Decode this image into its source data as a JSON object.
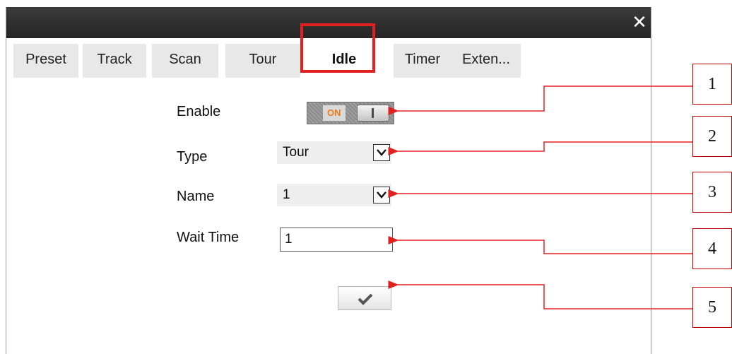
{
  "dialog": {
    "close_glyph": "✕",
    "tabs": [
      "Preset",
      "Track",
      "Scan",
      "Tour",
      "Idle",
      "Timer",
      "Exten..."
    ],
    "active_tab": "Idle"
  },
  "form": {
    "enable_label": "Enable",
    "enable_toggle_text": "ON",
    "type_label": "Type",
    "type_value": "Tour",
    "name_label": "Name",
    "name_value": "1",
    "wait_time_label": "Wait Time",
    "wait_time_value": "1"
  },
  "callouts": [
    "1",
    "2",
    "3",
    "4",
    "5"
  ],
  "colors": {
    "titlebar": "#2e2e2e",
    "highlight": "#e32020",
    "callout_border": "#c00000",
    "toggle_on_text": "#f07a18"
  },
  "icons": {
    "close": "close-icon",
    "dropdown": "chevron-down-icon",
    "confirm": "checkmark-icon",
    "toggle": "toggle-switch-icon"
  }
}
